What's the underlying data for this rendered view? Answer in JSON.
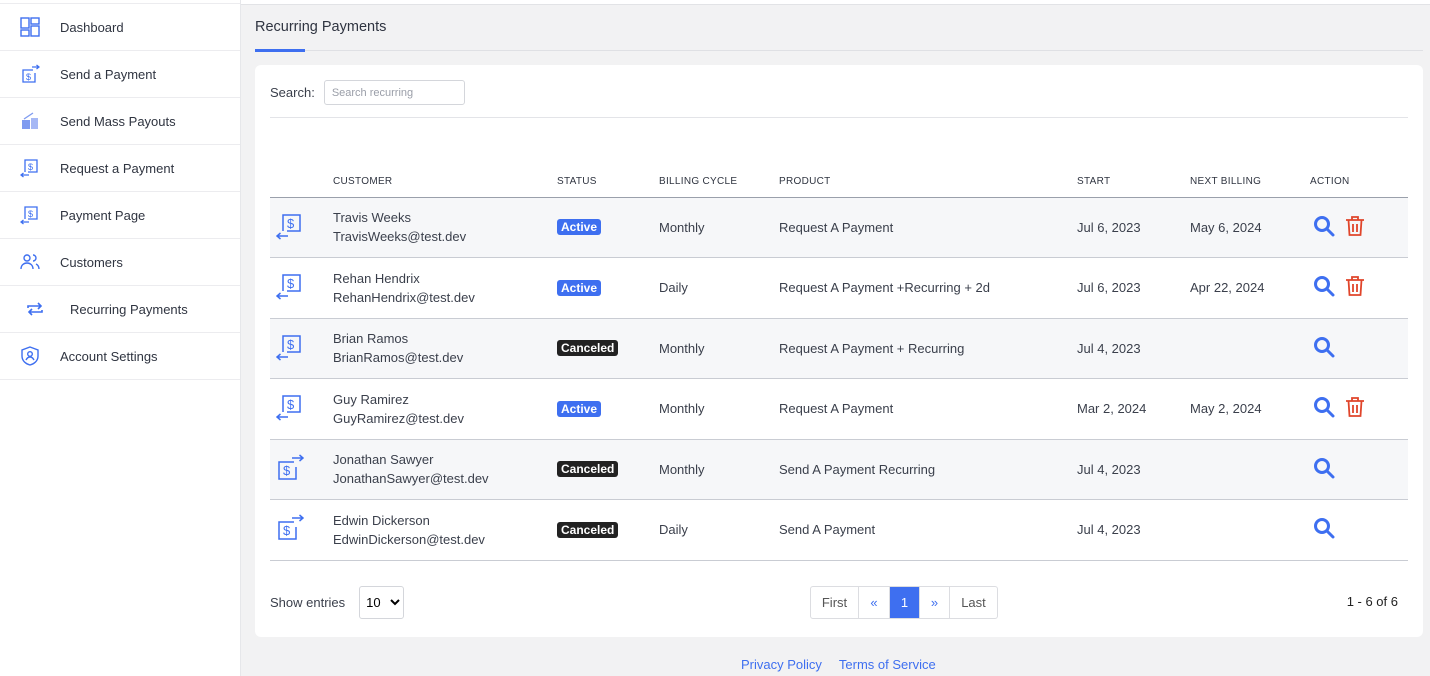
{
  "sidebar": {
    "items": [
      {
        "label": "Dashboard",
        "icon": "dashboard-icon"
      },
      {
        "label": "Send a Payment",
        "icon": "send-payment-icon"
      },
      {
        "label": "Send Mass Payouts",
        "icon": "mass-payouts-icon"
      },
      {
        "label": "Request a Payment",
        "icon": "request-payment-icon"
      },
      {
        "label": "Payment Page",
        "icon": "payment-page-icon"
      },
      {
        "label": "Customers",
        "icon": "customers-icon"
      },
      {
        "label": "Recurring Payments",
        "icon": "recurring-icon"
      },
      {
        "label": "Account Settings",
        "icon": "shield-user-icon"
      }
    ]
  },
  "page": {
    "title": "Recurring Payments"
  },
  "search": {
    "label": "Search:",
    "placeholder": "Search recurring",
    "value": ""
  },
  "table": {
    "headers": [
      "CUSTOMER",
      "STATUS",
      "BILLING CYCLE",
      "PRODUCT",
      "START",
      "NEXT BILLING",
      "ACTION"
    ],
    "rows": [
      {
        "type": "request",
        "name": "Travis Weeks",
        "email": "TravisWeeks@test.dev",
        "status": "Active",
        "cycle": "Monthly",
        "product": "Request A Payment",
        "start": "Jul 6, 2023",
        "next": "May 6, 2024",
        "delete": true
      },
      {
        "type": "request",
        "name": "Rehan Hendrix",
        "email": "RehanHendrix@test.dev",
        "status": "Active",
        "cycle": "Daily",
        "product": "Request A Payment +Recurring + 2d",
        "start": "Jul 6, 2023",
        "next": "Apr 22, 2024",
        "delete": true
      },
      {
        "type": "request",
        "name": "Brian Ramos",
        "email": "BrianRamos@test.dev",
        "status": "Canceled",
        "cycle": "Monthly",
        "product": "Request A Payment + Recurring",
        "start": "Jul 4, 2023",
        "next": "",
        "delete": false
      },
      {
        "type": "request",
        "name": "Guy Ramirez",
        "email": "GuyRamirez@test.dev",
        "status": "Active",
        "cycle": "Monthly",
        "product": "Request A Payment",
        "start": "Mar 2, 2024",
        "next": "May 2, 2024",
        "delete": true
      },
      {
        "type": "send",
        "name": "Jonathan Sawyer",
        "email": "JonathanSawyer@test.dev",
        "status": "Canceled",
        "cycle": "Monthly",
        "product": "Send A Payment Recurring",
        "start": "Jul 4, 2023",
        "next": "",
        "delete": false
      },
      {
        "type": "send",
        "name": "Edwin Dickerson",
        "email": "EdwinDickerson@test.dev",
        "status": "Canceled",
        "cycle": "Daily",
        "product": "Send A Payment",
        "start": "Jul 4, 2023",
        "next": "",
        "delete": false
      }
    ]
  },
  "footer": {
    "show_entries": "Show entries",
    "entries_value": "10",
    "pager": {
      "first": "First",
      "prev": "«",
      "current": "1",
      "next": "»",
      "last": "Last"
    },
    "count": "1 - 6 of 6"
  },
  "links": {
    "privacy": "Privacy Policy",
    "terms": "Terms of Service"
  },
  "colors": {
    "accent": "#3e6ff0",
    "active": "#3e6ff0",
    "canceled": "#222222",
    "delete": "#e0452b"
  }
}
